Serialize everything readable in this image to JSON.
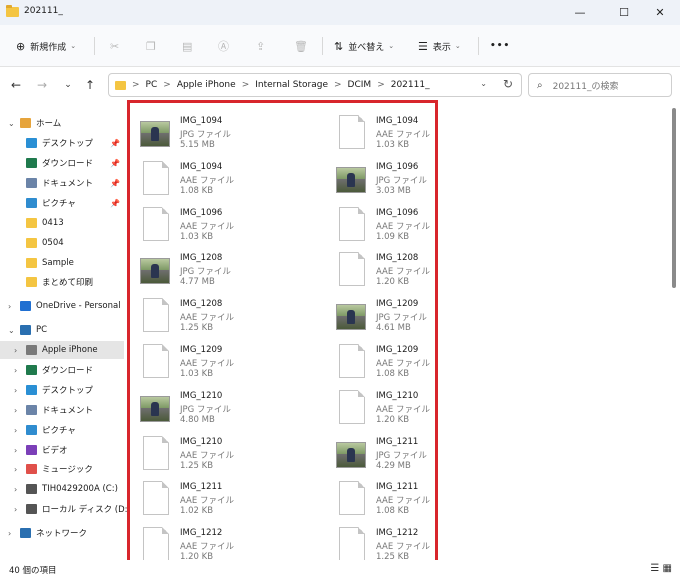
{
  "window": {
    "title": "202111_",
    "min": "—",
    "max": "☐",
    "close": "✕"
  },
  "toolbar": {
    "new_label": "新規作成",
    "sort_label": "並べ替え",
    "view_label": "表示",
    "more": "•••"
  },
  "nav": {
    "back": "←",
    "forward": "→",
    "recent": "⌄",
    "up": "↑",
    "breadcrumb": [
      "PC",
      "Apple iPhone",
      "Internal Storage",
      "DCIM",
      "202111_"
    ],
    "crumb_sep": ">",
    "refresh": "↻",
    "search_placeholder": "202111_の検索"
  },
  "sidebar": {
    "items": [
      {
        "label": "ホーム",
        "icon": "home-icon",
        "color": "#e6a43c"
      },
      {
        "label": "デスクトップ",
        "icon": "desktop-icon",
        "color": "#2a8fd4",
        "pinned": true
      },
      {
        "label": "ダウンロード",
        "icon": "download-icon",
        "color": "#1f7a4d",
        "pinned": true
      },
      {
        "label": "ドキュメント",
        "icon": "documents-icon",
        "color": "#6b84a8",
        "pinned": true
      },
      {
        "label": "ピクチャ",
        "icon": "pictures-icon",
        "color": "#2f8ccf",
        "pinned": true
      },
      {
        "label": "0413",
        "icon": "folder-icon",
        "color": "#f4c542"
      },
      {
        "label": "0504",
        "icon": "folder-icon",
        "color": "#f4c542"
      },
      {
        "label": "Sample",
        "icon": "folder-icon",
        "color": "#f4c542"
      },
      {
        "label": "まとめて印刷",
        "icon": "folder-icon",
        "color": "#f4c542"
      },
      {
        "label": "OneDrive - Personal",
        "icon": "onedrive-icon",
        "color": "#1f6fd1"
      },
      {
        "label": "PC",
        "icon": "pc-icon",
        "color": "#2a6fb0"
      },
      {
        "label": "Apple iPhone",
        "icon": "phone-icon",
        "color": "#7a7a7a"
      },
      {
        "label": "ダウンロード",
        "icon": "download-icon",
        "color": "#1f7a4d"
      },
      {
        "label": "デスクトップ",
        "icon": "desktop-icon",
        "color": "#2a8fd4"
      },
      {
        "label": "ドキュメント",
        "icon": "documents-icon",
        "color": "#6b84a8"
      },
      {
        "label": "ピクチャ",
        "icon": "pictures-icon",
        "color": "#2f8ccf"
      },
      {
        "label": "ビデオ",
        "icon": "video-icon",
        "color": "#7b3fb8"
      },
      {
        "label": "ミュージック",
        "icon": "music-icon",
        "color": "#e0504a"
      },
      {
        "label": "TIH0429200A (C:)",
        "icon": "drive-icon",
        "color": "#555555"
      },
      {
        "label": "ローカル ディスク (D:)",
        "icon": "drive-icon",
        "color": "#555555"
      },
      {
        "label": "ネットワーク",
        "icon": "network-icon",
        "color": "#2a6fb0"
      }
    ],
    "pin_glyph": "📌"
  },
  "files": [
    {
      "name": "IMG_1094",
      "type": "JPG ファイル",
      "size": "5.15 MB",
      "thumb": true
    },
    {
      "name": "IMG_1094",
      "type": "AAE ファイル",
      "size": "1.03 KB",
      "thumb": false
    },
    {
      "name": "IMG_1094",
      "type": "AAE ファイル",
      "size": "1.08 KB",
      "thumb": false
    },
    {
      "name": "IMG_1096",
      "type": "JPG ファイル",
      "size": "3.03 MB",
      "thumb": true
    },
    {
      "name": "IMG_1096",
      "type": "AAE ファイル",
      "size": "1.03 KB",
      "thumb": false
    },
    {
      "name": "IMG_1096",
      "type": "AAE ファイル",
      "size": "1.09 KB",
      "thumb": false
    },
    {
      "name": "IMG_1208",
      "type": "JPG ファイル",
      "size": "4.77 MB",
      "thumb": true
    },
    {
      "name": "IMG_1208",
      "type": "AAE ファイル",
      "size": "1.20 KB",
      "thumb": false
    },
    {
      "name": "IMG_1208",
      "type": "AAE ファイル",
      "size": "1.25 KB",
      "thumb": false
    },
    {
      "name": "IMG_1209",
      "type": "JPG ファイル",
      "size": "4.61 MB",
      "thumb": true
    },
    {
      "name": "IMG_1209",
      "type": "AAE ファイル",
      "size": "1.03 KB",
      "thumb": false
    },
    {
      "name": "IMG_1209",
      "type": "AAE ファイル",
      "size": "1.08 KB",
      "thumb": false
    },
    {
      "name": "IMG_1210",
      "type": "JPG ファイル",
      "size": "4.80 MB",
      "thumb": true
    },
    {
      "name": "IMG_1210",
      "type": "AAE ファイル",
      "size": "1.20 KB",
      "thumb": false
    },
    {
      "name": "IMG_1210",
      "type": "AAE ファイル",
      "size": "1.25 KB",
      "thumb": false
    },
    {
      "name": "IMG_1211",
      "type": "JPG ファイル",
      "size": "4.29 MB",
      "thumb": true
    },
    {
      "name": "IMG_1211",
      "type": "AAE ファイル",
      "size": "1.02 KB",
      "thumb": false
    },
    {
      "name": "IMG_1211",
      "type": "AAE ファイル",
      "size": "1.08 KB",
      "thumb": false
    },
    {
      "name": "IMG_1212",
      "type": "AAE ファイル",
      "size": "1.20 KB",
      "thumb": false
    },
    {
      "name": "IMG_1212",
      "type": "AAE ファイル",
      "size": "1.25 KB",
      "thumb": false
    }
  ],
  "status": {
    "count": "40 個の項目"
  },
  "colors": {
    "highlight_border": "#d8262c",
    "selected_bg": "#e5e5e5"
  }
}
